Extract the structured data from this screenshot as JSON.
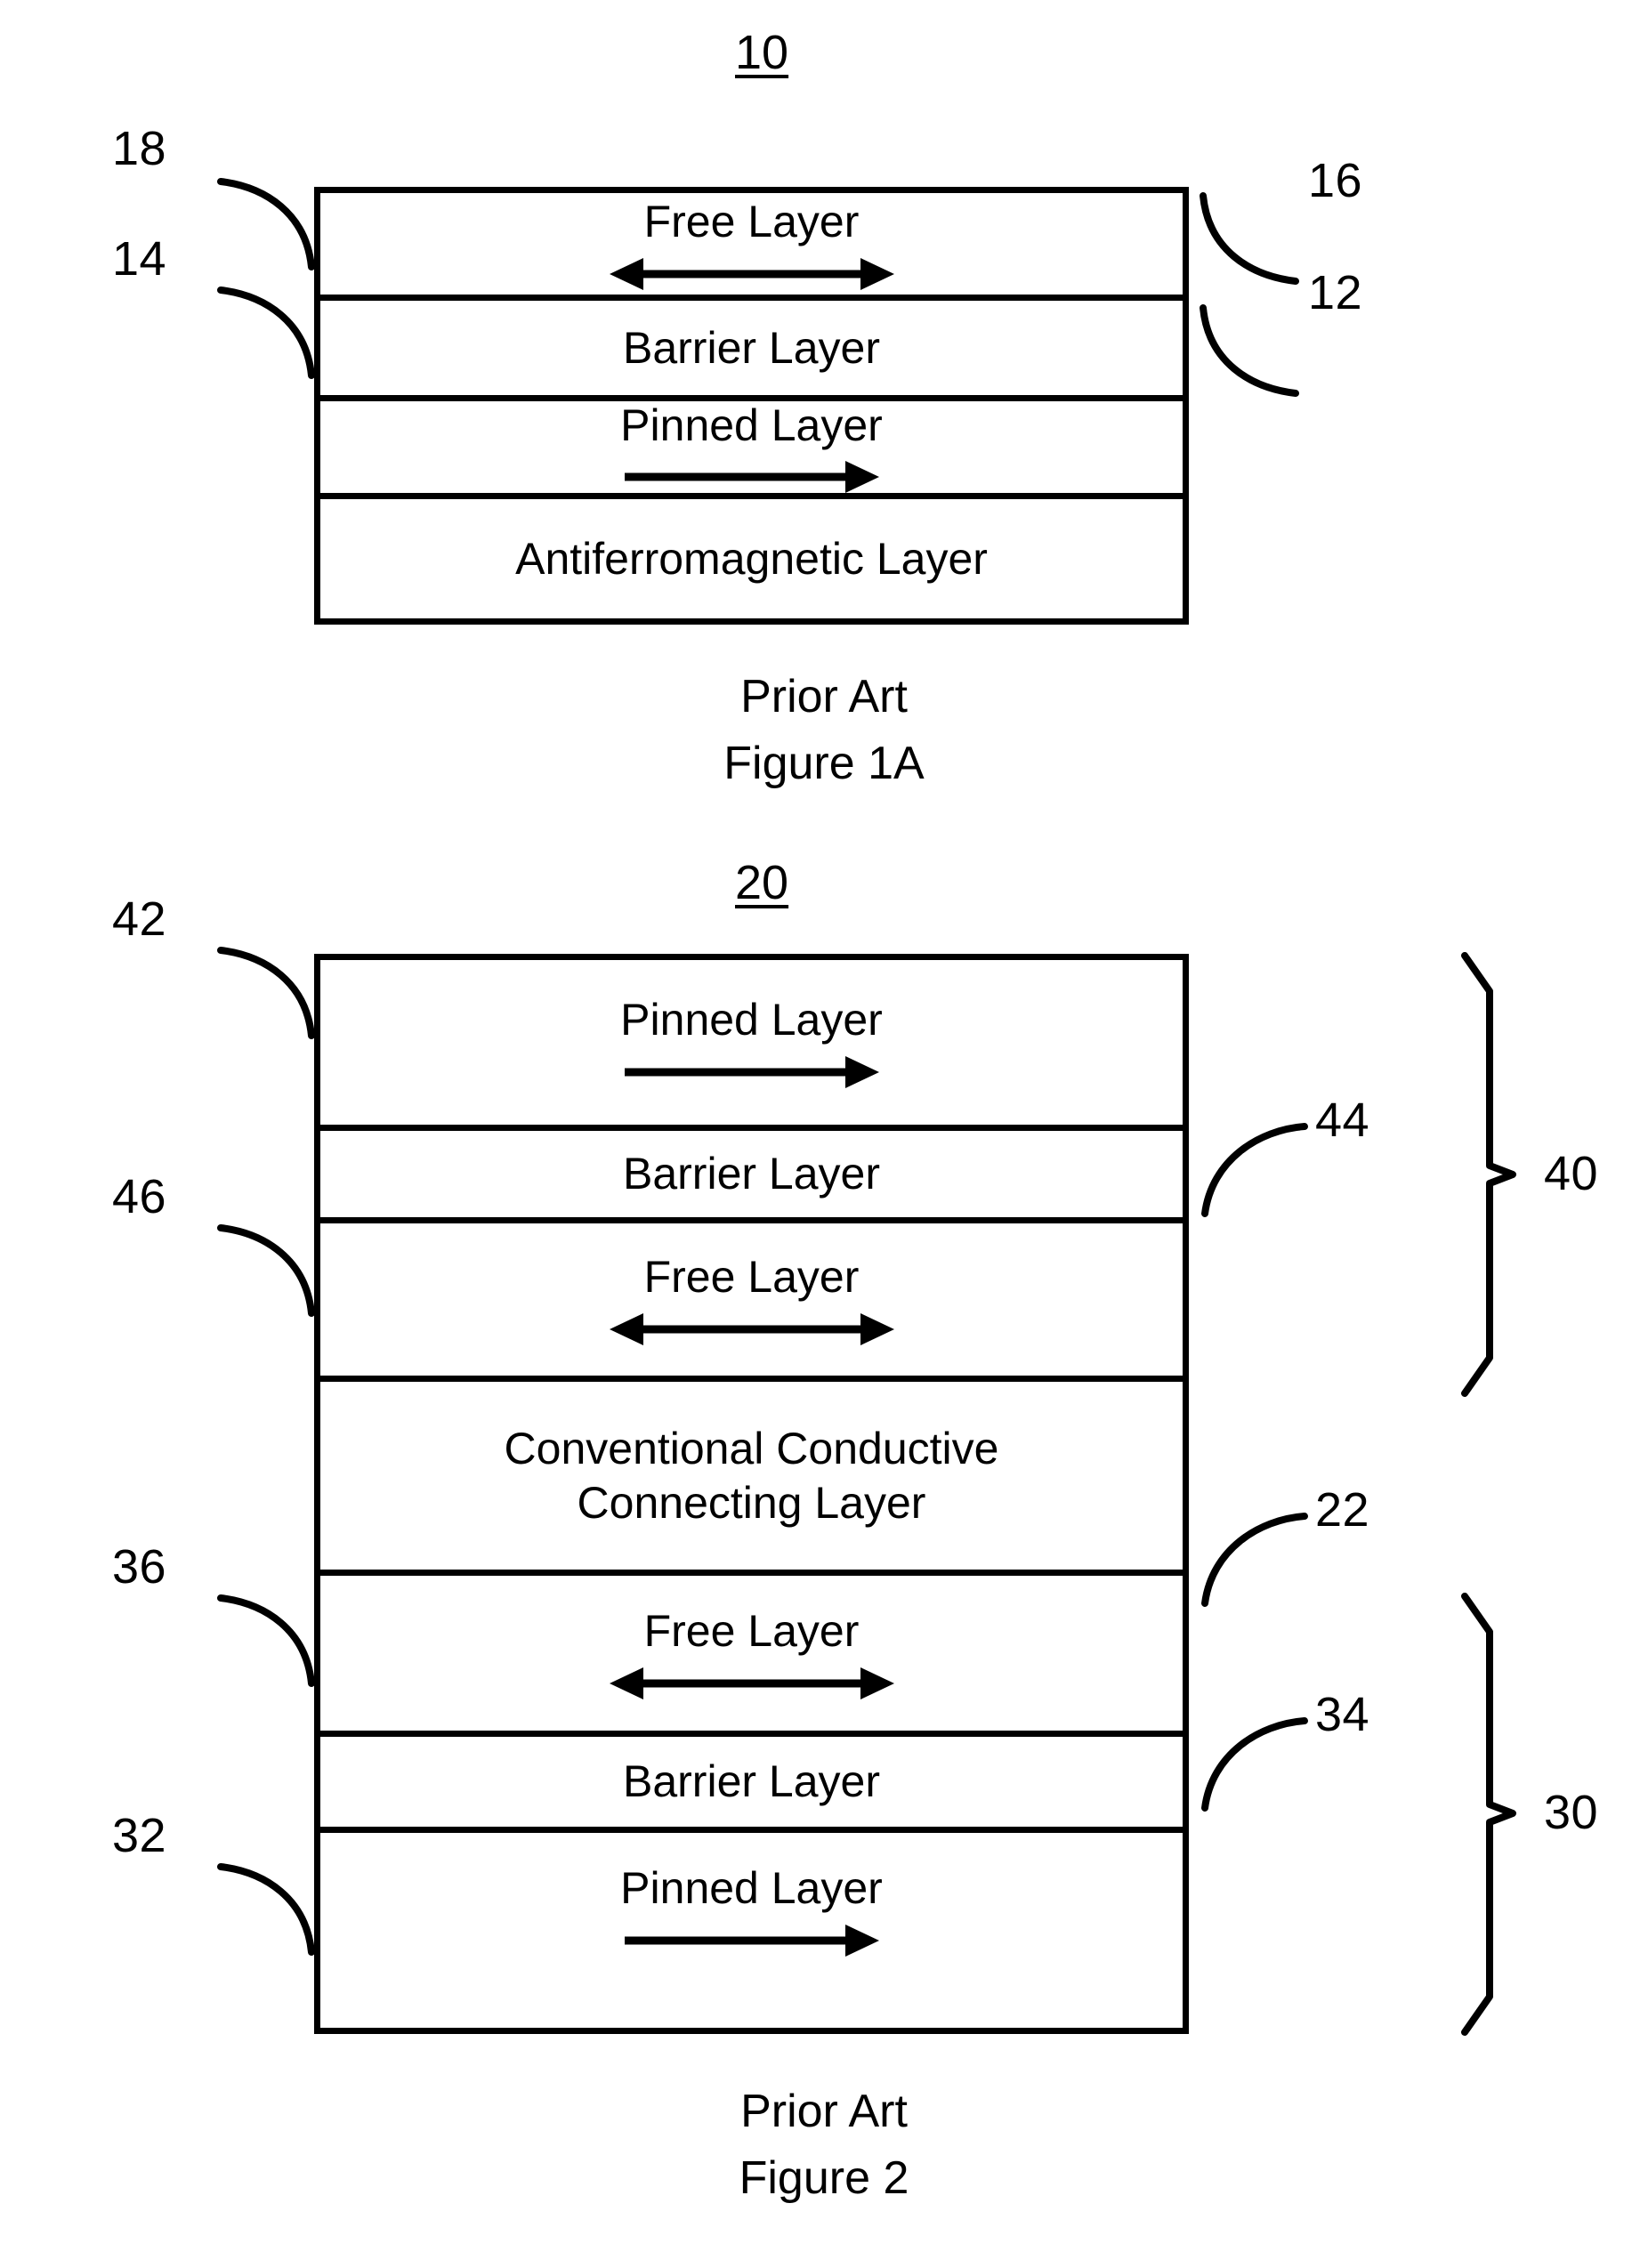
{
  "document": {
    "type": "patent-drawing-sheet",
    "line_color": "#000000",
    "background_color": "#ffffff"
  },
  "figure1a": {
    "figure_number": "10",
    "caption_line1": "Prior Art",
    "caption_line2": "Figure 1A",
    "layers": [
      {
        "label": "Free Layer",
        "arrow": "double-headed-horizontal-arrow",
        "reference": "18",
        "reference_side": "left"
      },
      {
        "label": "Barrier Layer",
        "arrow": "none",
        "reference": "16",
        "reference_side": "right"
      },
      {
        "label": "Pinned Layer",
        "arrow": "right-headed-horizontal-arrow",
        "reference": "14",
        "reference_side": "left"
      },
      {
        "label": "Antiferromagnetic Layer",
        "arrow": "none",
        "reference": "12",
        "reference_side": "right"
      }
    ]
  },
  "figure2": {
    "figure_number": "20",
    "caption_line1": "Prior Art",
    "caption_line2": "Figure 2",
    "layers": [
      {
        "label": "Pinned Layer",
        "arrow": "right-headed-horizontal-arrow",
        "reference": "42",
        "reference_side": "left"
      },
      {
        "label": "Barrier Layer",
        "arrow": "none",
        "reference": "44",
        "reference_side": "right"
      },
      {
        "label": "Free Layer",
        "arrow": "double-headed-horizontal-arrow",
        "reference": "46",
        "reference_side": "left"
      },
      {
        "label": "Conventional Conductive\nConnecting Layer",
        "arrow": "none",
        "reference": "22",
        "reference_side": "right"
      },
      {
        "label": "Free Layer",
        "arrow": "double-headed-horizontal-arrow",
        "reference": "36",
        "reference_side": "left"
      },
      {
        "label": "Barrier Layer",
        "arrow": "none",
        "reference": "34",
        "reference_side": "right"
      },
      {
        "label": "Pinned Layer",
        "arrow": "right-headed-horizontal-arrow",
        "reference": "32",
        "reference_side": "left"
      }
    ],
    "group_braces": [
      {
        "reference": "40",
        "spans_labels": [
          "Pinned Layer",
          "Barrier Layer",
          "Free Layer"
        ]
      },
      {
        "reference": "30",
        "spans_labels": [
          "Free Layer",
          "Barrier Layer",
          "Pinned Layer"
        ]
      }
    ]
  }
}
